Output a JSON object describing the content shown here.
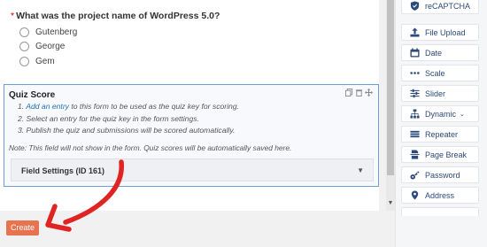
{
  "question": {
    "required_mark": "*",
    "text": "What was the project name of WordPress 5.0?",
    "choices": [
      "Gutenberg",
      "George",
      "Gem"
    ]
  },
  "quiz": {
    "title": "Quiz Score",
    "step1_prefix": "1.",
    "step1_link": "Add an entry",
    "step1_suffix": "to this form to be used as the quiz key for scoring.",
    "step2": "2. Select an entry for the quiz key in the form settings.",
    "step3": "3. Publish the quiz and submissions will be scored automatically.",
    "note": "Note: This field will not show in the form. Quiz scores will be automatically saved here.",
    "field_settings": "Field Settings (ID 161)"
  },
  "create_label": "Create",
  "sidebar": {
    "items": [
      {
        "label": "reCAPTCHA",
        "icon": "shield-icon"
      },
      {
        "label": "File Upload",
        "icon": "upload-icon"
      },
      {
        "label": "Date",
        "icon": "calendar-icon"
      },
      {
        "label": "Scale",
        "icon": "dots-icon"
      },
      {
        "label": "Slider",
        "icon": "sliders-icon"
      },
      {
        "label": "Dynamic",
        "icon": "sitemap-icon"
      },
      {
        "label": "Repeater",
        "icon": "repeat-icon"
      },
      {
        "label": "Page Break",
        "icon": "page-break-icon"
      },
      {
        "label": "Password",
        "icon": "key-icon"
      },
      {
        "label": "Address",
        "icon": "map-pin-icon"
      }
    ]
  },
  "colors": {
    "accent": "#e8734f",
    "sidebar_text": "#2c4a7a",
    "annotation_arrow": "#e02424"
  }
}
